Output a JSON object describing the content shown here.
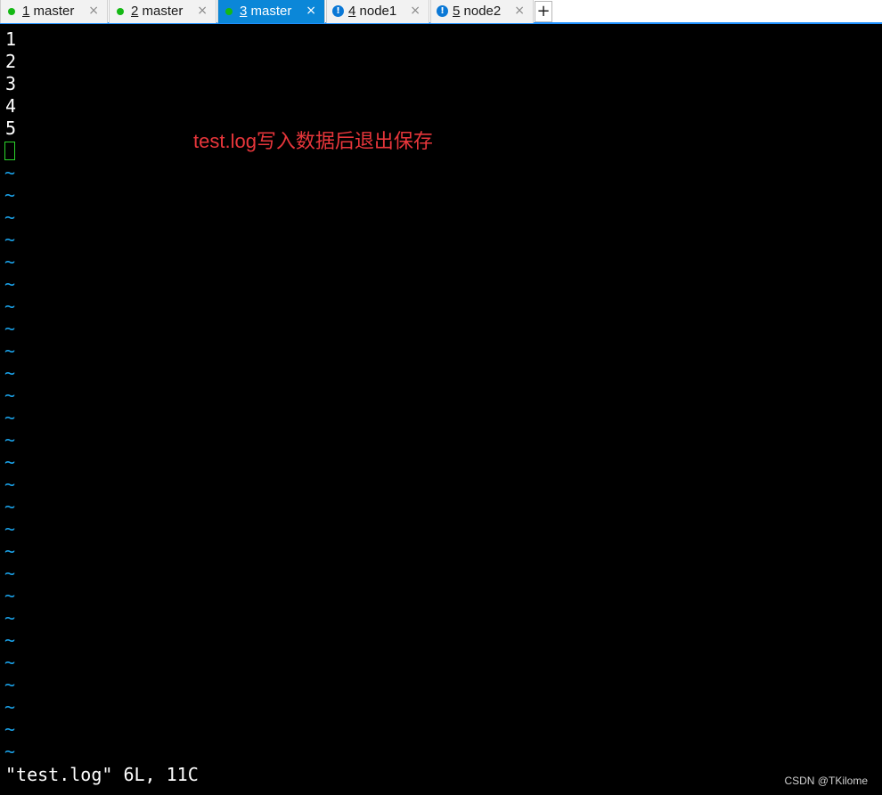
{
  "tabs": [
    {
      "num": "1",
      "name": " master",
      "status": "connected",
      "active": false
    },
    {
      "num": "2",
      "name": " master",
      "status": "connected",
      "active": false
    },
    {
      "num": "3",
      "name": " master",
      "status": "connected",
      "active": true
    },
    {
      "num": "4",
      "name": " node1",
      "status": "warning",
      "active": false
    },
    {
      "num": "5",
      "name": " node2",
      "status": "warning",
      "active": false
    }
  ],
  "tab_close_glyph": "×",
  "new_tab_glyph": "+",
  "warning_glyph": "!",
  "editor": {
    "lines": [
      "1",
      "2",
      "3",
      "4",
      "5"
    ],
    "tilde": "~",
    "tilde_count": 27
  },
  "annotation": "test.log写入数据后退出保存",
  "status_message": "\"test.log\" 6L, 11C",
  "watermark": "CSDN @TKilome",
  "colors": {
    "tab_active": "#0b87d8",
    "status_connected": "#14b814",
    "status_warning": "#0a78d6",
    "tilde": "#1aa0e6",
    "cursor": "#2bd42b",
    "annotation": "#e8363b"
  }
}
